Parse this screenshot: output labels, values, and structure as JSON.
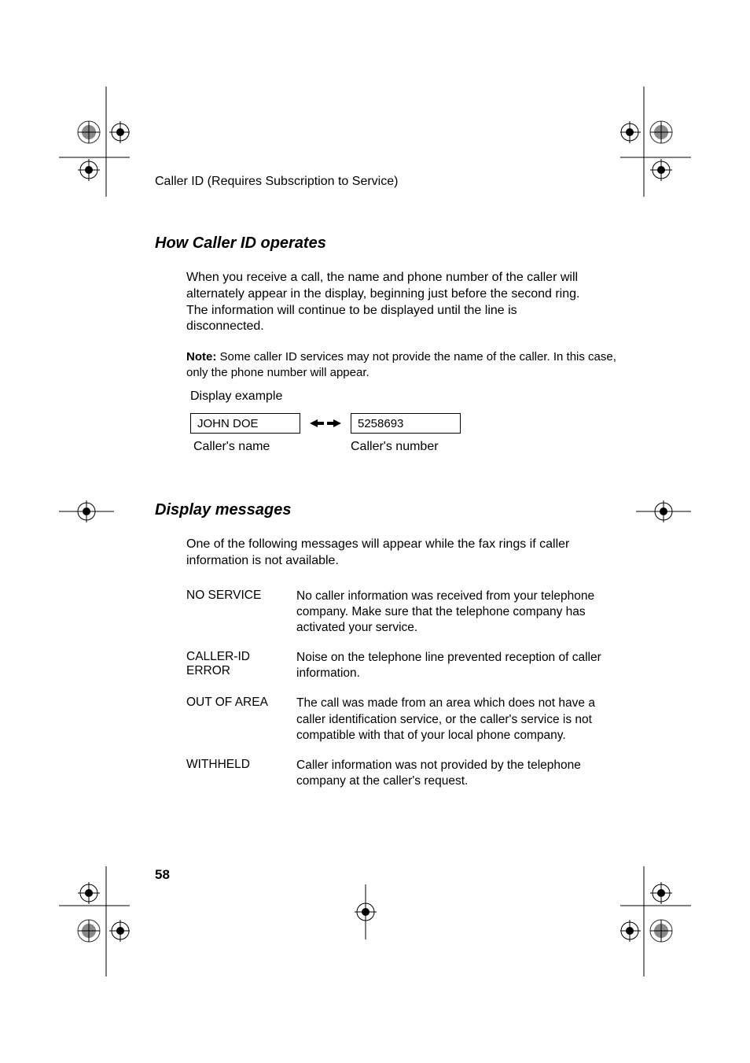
{
  "header": "Caller ID (Requires Subscription to Service)",
  "section1": {
    "heading": "How Caller ID operates",
    "body": "When you receive a call, the name and phone number of the caller will alternately appear in the display, beginning just before the second ring. The information will continue to be displayed until the line is disconnected.",
    "note_label": "Note:",
    "note_body": " Some caller ID services may not provide the name of the caller. In this case, only the phone number will appear.",
    "display_example_label": "Display example",
    "caller_name_box": "JOHN DOE",
    "caller_number_box": "5258693",
    "caller_name_caption": "Caller's name",
    "caller_number_caption": "Caller's number"
  },
  "section2": {
    "heading": "Display messages",
    "intro": "One of the following messages will appear while the fax rings if caller information is not available.",
    "messages": [
      {
        "term": "NO SERVICE",
        "desc": "No caller information was received from your telephone company. Make sure that the telephone company has activated your service."
      },
      {
        "term": "CALLER-ID ERROR",
        "desc": "Noise on the telephone line prevented reception of caller information."
      },
      {
        "term": "OUT OF AREA",
        "desc": "The call was made from an area which does not have a caller identification service, or the caller's service is not compatible with that of your local phone company."
      },
      {
        "term": "WITHHELD",
        "desc": "Caller information was not provided by the telephone company at the caller's request."
      }
    ]
  },
  "page_number": "58"
}
